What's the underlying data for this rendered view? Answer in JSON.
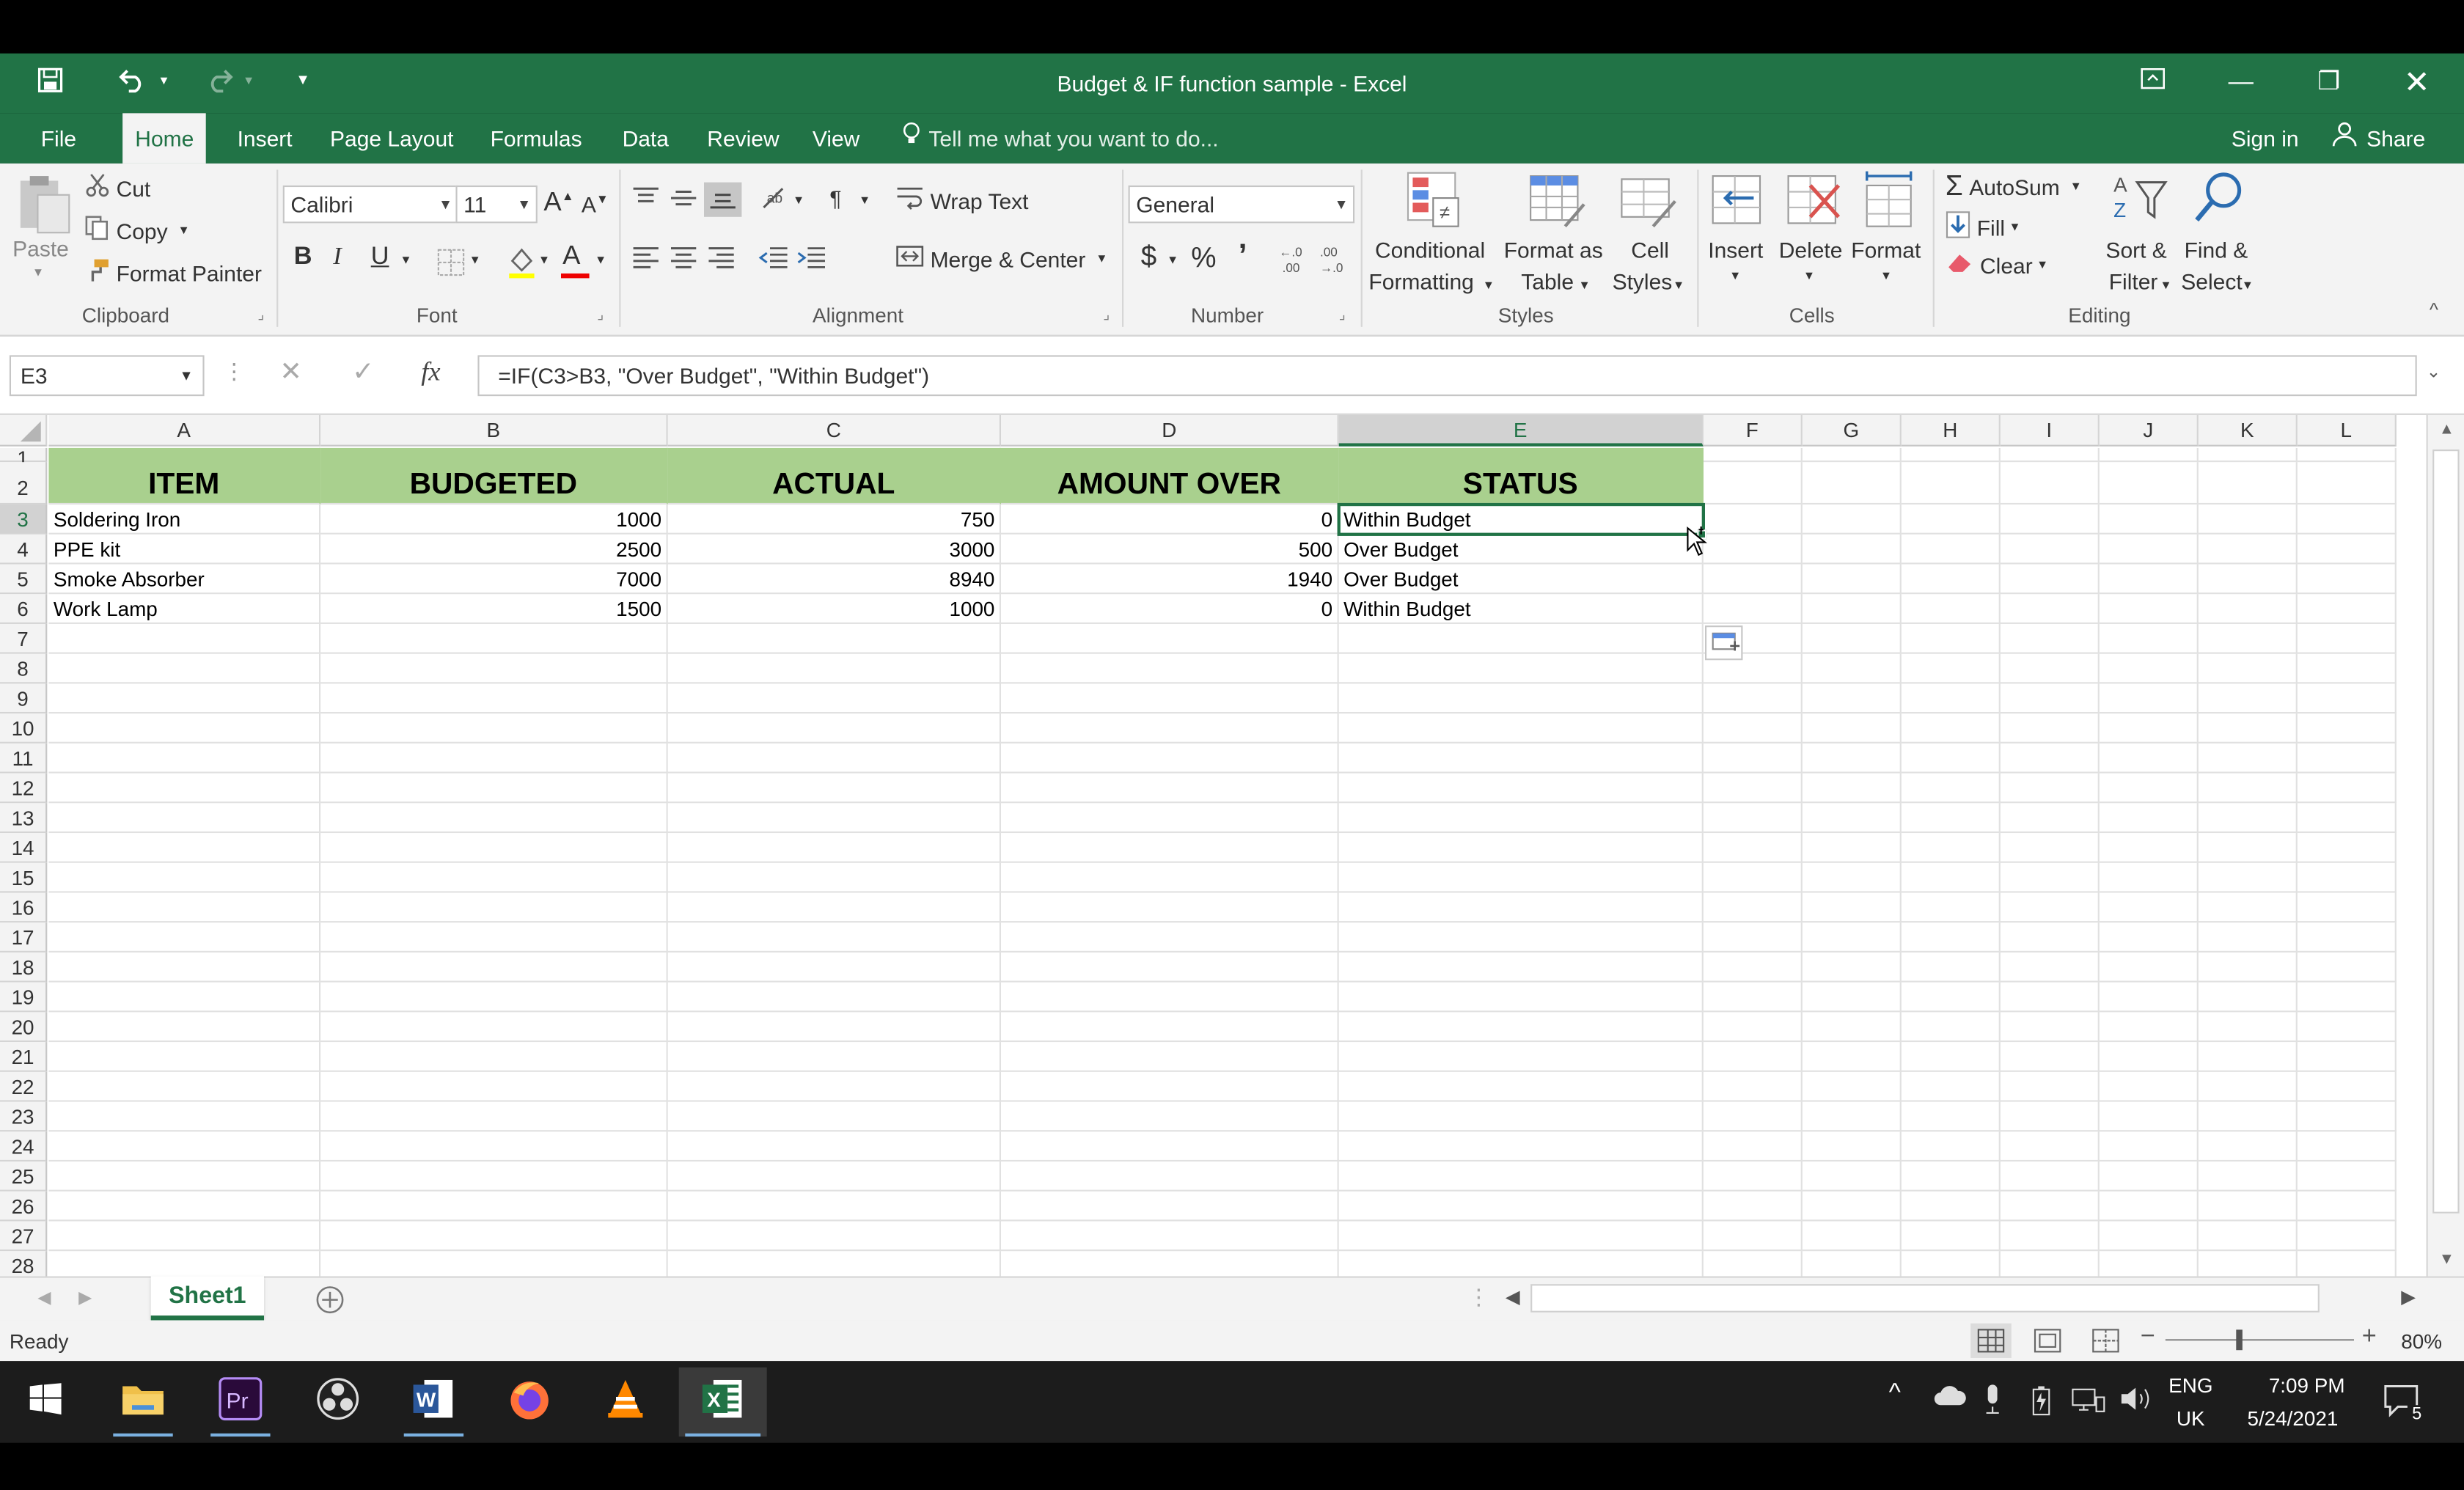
{
  "window": {
    "title": "Budget & IF function sample - Excel"
  },
  "tabs": [
    {
      "label": "File"
    },
    {
      "label": "Home"
    },
    {
      "label": "Insert"
    },
    {
      "label": "Page Layout"
    },
    {
      "label": "Formulas"
    },
    {
      "label": "Data"
    },
    {
      "label": "Review"
    },
    {
      "label": "View"
    }
  ],
  "tell_me": "Tell me what you want to do...",
  "account": {
    "sign_in": "Sign in",
    "share": "Share"
  },
  "ribbon": {
    "clipboard": {
      "paste": "Paste",
      "cut": "Cut",
      "copy": "Copy",
      "format_painter": "Format Painter",
      "label": "Clipboard"
    },
    "font": {
      "name": "Calibri",
      "size": "11",
      "bold": "B",
      "italic": "I",
      "underline": "U",
      "label": "Font"
    },
    "alignment": {
      "wrap_text": "Wrap Text",
      "merge_center": "Merge & Center",
      "label": "Alignment"
    },
    "number": {
      "format": "General",
      "currency": "$",
      "percent": "%",
      "comma": "’",
      "label": "Number"
    },
    "styles": {
      "conditional_1": "Conditional",
      "conditional_2": "Formatting",
      "format_table_1": "Format as",
      "format_table_2": "Table",
      "cell_styles_1": "Cell",
      "cell_styles_2": "Styles",
      "label": "Styles"
    },
    "cells": {
      "insert": "Insert",
      "delete": "Delete",
      "format": "Format",
      "label": "Cells"
    },
    "editing": {
      "autosum": "AutoSum",
      "fill": "Fill",
      "clear": "Clear",
      "sort_1": "Sort &",
      "sort_2": "Filter",
      "find_1": "Find &",
      "find_2": "Select",
      "label": "Editing"
    }
  },
  "formula_bar": {
    "name_box": "E3",
    "fx": "fx",
    "formula": "=IF(C3>B3, \"Over Budget\", \"Within Budget\")"
  },
  "grid": {
    "columns": [
      "A",
      "B",
      "C",
      "D",
      "E",
      "F",
      "G",
      "H",
      "I",
      "J",
      "K",
      "L"
    ],
    "headers": [
      "ITEM",
      "BUDGETED",
      "ACTUAL",
      "AMOUNT OVER",
      "STATUS"
    ],
    "rows": [
      [
        "Soldering Iron",
        "1000",
        "750",
        "0",
        "Within Budget"
      ],
      [
        "PPE kit",
        "2500",
        "3000",
        "500",
        "Over Budget"
      ],
      [
        "Smoke Absorber",
        "7000",
        "8940",
        "1940",
        "Over Budget"
      ],
      [
        "Work Lamp",
        "1500",
        "1000",
        "0",
        "Within Budget"
      ]
    ],
    "row_numbers": [
      "1",
      "2",
      "3",
      "4",
      "5",
      "6",
      "7",
      "8",
      "9",
      "10",
      "11",
      "12",
      "13",
      "14",
      "15",
      "16",
      "17",
      "18",
      "19",
      "20",
      "21",
      "22",
      "23",
      "24",
      "25",
      "26",
      "27",
      "28"
    ],
    "header_fill": "#a9d08e"
  },
  "sheet_tabs": {
    "active": "Sheet1"
  },
  "status": {
    "left": "Ready",
    "zoom": "80%"
  },
  "taskbar": {
    "lang_1": "ENG",
    "lang_2": "UK",
    "time": "7:09 PM",
    "date": "5/24/2021",
    "notifications": "5"
  },
  "colors": {
    "excel_green": "#217346",
    "header_green": "#a9d08e"
  }
}
